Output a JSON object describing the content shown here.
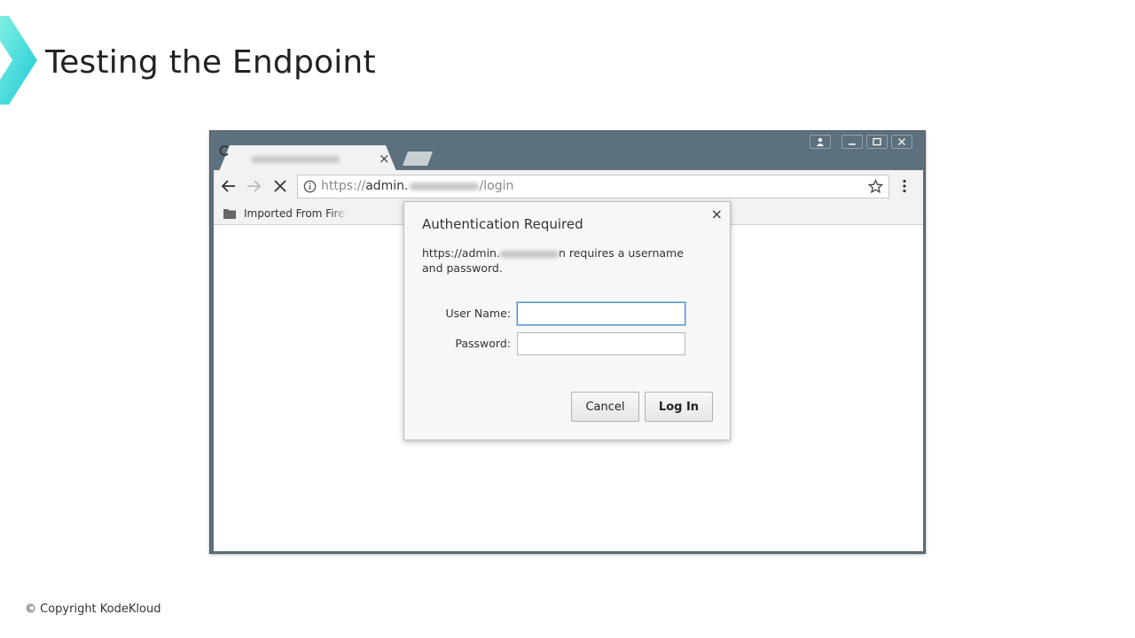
{
  "slide": {
    "title": "Testing the Endpoint",
    "copyright": "© Copyright KodeKloud"
  },
  "browser": {
    "tab": {
      "close_label": "×"
    },
    "address_bar": {
      "scheme": "https://",
      "host_prefix": "admin.",
      "path": "/login"
    },
    "bookmarks": [
      {
        "label": "Imported From Firef"
      }
    ]
  },
  "auth_dialog": {
    "title": "Authentication Required",
    "close_label": "×",
    "message_prefix": "https://admin.",
    "message_suffix": "n requires a username and password.",
    "username_label": "User Name:",
    "password_label": "Password:",
    "username_value": "",
    "password_value": "",
    "cancel_label": "Cancel",
    "login_label": "Log In"
  },
  "colors": {
    "frame": "#5c717d",
    "logo": "#2ed3d3",
    "focus_ring": "#4a90d9"
  }
}
